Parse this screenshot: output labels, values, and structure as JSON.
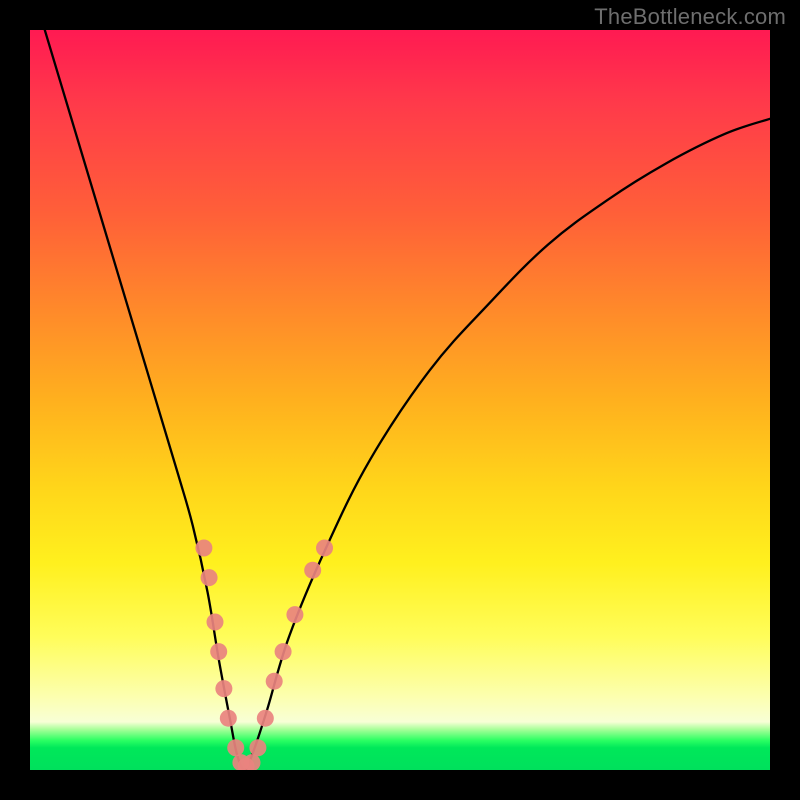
{
  "watermark": {
    "text": "TheBottleneck.com"
  },
  "colors": {
    "curve_stroke": "#000000",
    "marker_fill": "#e9837f",
    "marker_stroke": "#e9837f"
  },
  "chart_data": {
    "type": "line",
    "title": "",
    "xlabel": "",
    "ylabel": "",
    "xlim": [
      0,
      100
    ],
    "ylim": [
      0,
      100
    ],
    "grid": false,
    "legend": false,
    "series": [
      {
        "name": "bottleneck-curve",
        "x": [
          2,
          5,
          8,
          11,
          14,
          17,
          20,
          22,
          24,
          25.5,
          27,
          28,
          29,
          30,
          32,
          35,
          40,
          46,
          54,
          62,
          70,
          78,
          86,
          94,
          100
        ],
        "y": [
          100,
          90,
          80,
          70,
          60,
          50,
          40,
          33,
          24,
          15,
          7,
          2,
          0,
          2,
          8,
          18,
          30,
          42,
          54,
          63,
          71,
          77,
          82,
          86,
          88
        ]
      }
    ],
    "markers": [
      {
        "x": 23.5,
        "y": 30
      },
      {
        "x": 24.2,
        "y": 26
      },
      {
        "x": 25.0,
        "y": 20
      },
      {
        "x": 25.5,
        "y": 16
      },
      {
        "x": 26.2,
        "y": 11
      },
      {
        "x": 26.8,
        "y": 7
      },
      {
        "x": 27.8,
        "y": 3
      },
      {
        "x": 28.5,
        "y": 1
      },
      {
        "x": 29.2,
        "y": 0.5
      },
      {
        "x": 30.0,
        "y": 1
      },
      {
        "x": 30.8,
        "y": 3
      },
      {
        "x": 31.8,
        "y": 7
      },
      {
        "x": 33.0,
        "y": 12
      },
      {
        "x": 34.2,
        "y": 16
      },
      {
        "x": 35.8,
        "y": 21
      },
      {
        "x": 38.2,
        "y": 27
      },
      {
        "x": 39.8,
        "y": 30
      }
    ]
  }
}
